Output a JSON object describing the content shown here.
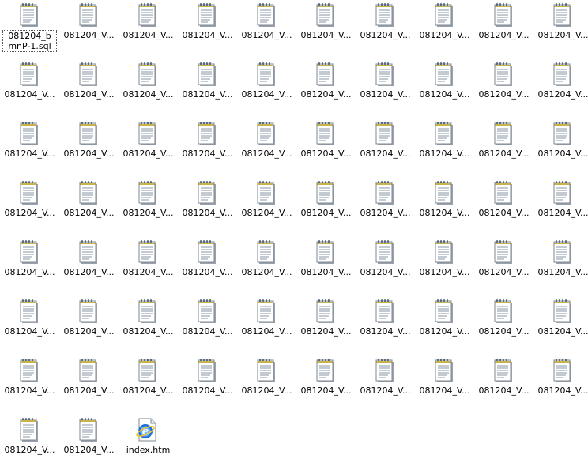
{
  "files": [
    {
      "label": "081204_bmnP-1.sql",
      "type": "notepad",
      "selected": true
    },
    {
      "label": "081204_V...",
      "type": "notepad"
    },
    {
      "label": "081204_V...",
      "type": "notepad"
    },
    {
      "label": "081204_V...",
      "type": "notepad"
    },
    {
      "label": "081204_V...",
      "type": "notepad"
    },
    {
      "label": "081204_V...",
      "type": "notepad"
    },
    {
      "label": "081204_V...",
      "type": "notepad"
    },
    {
      "label": "081204_V...",
      "type": "notepad"
    },
    {
      "label": "081204_V...",
      "type": "notepad"
    },
    {
      "label": "081204_V...",
      "type": "notepad"
    },
    {
      "label": "081204_V...",
      "type": "notepad"
    },
    {
      "label": "081204_V...",
      "type": "notepad"
    },
    {
      "label": "081204_V...",
      "type": "notepad"
    },
    {
      "label": "081204_V...",
      "type": "notepad"
    },
    {
      "label": "081204_V...",
      "type": "notepad"
    },
    {
      "label": "081204_V...",
      "type": "notepad"
    },
    {
      "label": "081204_V...",
      "type": "notepad"
    },
    {
      "label": "081204_V...",
      "type": "notepad"
    },
    {
      "label": "081204_V...",
      "type": "notepad"
    },
    {
      "label": "081204_V...",
      "type": "notepad"
    },
    {
      "label": "081204_V...",
      "type": "notepad"
    },
    {
      "label": "081204_V...",
      "type": "notepad"
    },
    {
      "label": "081204_V...",
      "type": "notepad"
    },
    {
      "label": "081204_V...",
      "type": "notepad"
    },
    {
      "label": "081204_V...",
      "type": "notepad"
    },
    {
      "label": "081204_V...",
      "type": "notepad"
    },
    {
      "label": "081204_V...",
      "type": "notepad"
    },
    {
      "label": "081204_V...",
      "type": "notepad"
    },
    {
      "label": "081204_V...",
      "type": "notepad"
    },
    {
      "label": "081204_V...",
      "type": "notepad"
    },
    {
      "label": "081204_V...",
      "type": "notepad"
    },
    {
      "label": "081204_V...",
      "type": "notepad"
    },
    {
      "label": "081204_V...",
      "type": "notepad"
    },
    {
      "label": "081204_V...",
      "type": "notepad"
    },
    {
      "label": "081204_V...",
      "type": "notepad"
    },
    {
      "label": "081204_V...",
      "type": "notepad"
    },
    {
      "label": "081204_V...",
      "type": "notepad"
    },
    {
      "label": "081204_V...",
      "type": "notepad"
    },
    {
      "label": "081204_V...",
      "type": "notepad"
    },
    {
      "label": "081204_V...",
      "type": "notepad"
    },
    {
      "label": "081204_V...",
      "type": "notepad"
    },
    {
      "label": "081204_V...",
      "type": "notepad"
    },
    {
      "label": "081204_V...",
      "type": "notepad"
    },
    {
      "label": "081204_V...",
      "type": "notepad"
    },
    {
      "label": "081204_V...",
      "type": "notepad"
    },
    {
      "label": "081204_V...",
      "type": "notepad"
    },
    {
      "label": "081204_V...",
      "type": "notepad"
    },
    {
      "label": "081204_V...",
      "type": "notepad"
    },
    {
      "label": "081204_V...",
      "type": "notepad"
    },
    {
      "label": "081204_V...",
      "type": "notepad"
    },
    {
      "label": "081204_V...",
      "type": "notepad"
    },
    {
      "label": "081204_V...",
      "type": "notepad"
    },
    {
      "label": "081204_V...",
      "type": "notepad"
    },
    {
      "label": "081204_V...",
      "type": "notepad"
    },
    {
      "label": "081204_V...",
      "type": "notepad"
    },
    {
      "label": "081204_V...",
      "type": "notepad"
    },
    {
      "label": "081204_V...",
      "type": "notepad"
    },
    {
      "label": "081204_V...",
      "type": "notepad"
    },
    {
      "label": "081204_V...",
      "type": "notepad"
    },
    {
      "label": "081204_V...",
      "type": "notepad"
    },
    {
      "label": "081204_V...",
      "type": "notepad"
    },
    {
      "label": "081204_V...",
      "type": "notepad"
    },
    {
      "label": "081204_V...",
      "type": "notepad"
    },
    {
      "label": "081204_V...",
      "type": "notepad"
    },
    {
      "label": "081204_V...",
      "type": "notepad"
    },
    {
      "label": "081204_V...",
      "type": "notepad"
    },
    {
      "label": "081204_V...",
      "type": "notepad"
    },
    {
      "label": "081204_V...",
      "type": "notepad"
    },
    {
      "label": "081204_V...",
      "type": "notepad"
    },
    {
      "label": "081204_V...",
      "type": "notepad"
    },
    {
      "label": "081204_V...",
      "type": "notepad"
    },
    {
      "label": "081204_V...",
      "type": "notepad"
    },
    {
      "label": "index.htm",
      "type": "html"
    }
  ]
}
